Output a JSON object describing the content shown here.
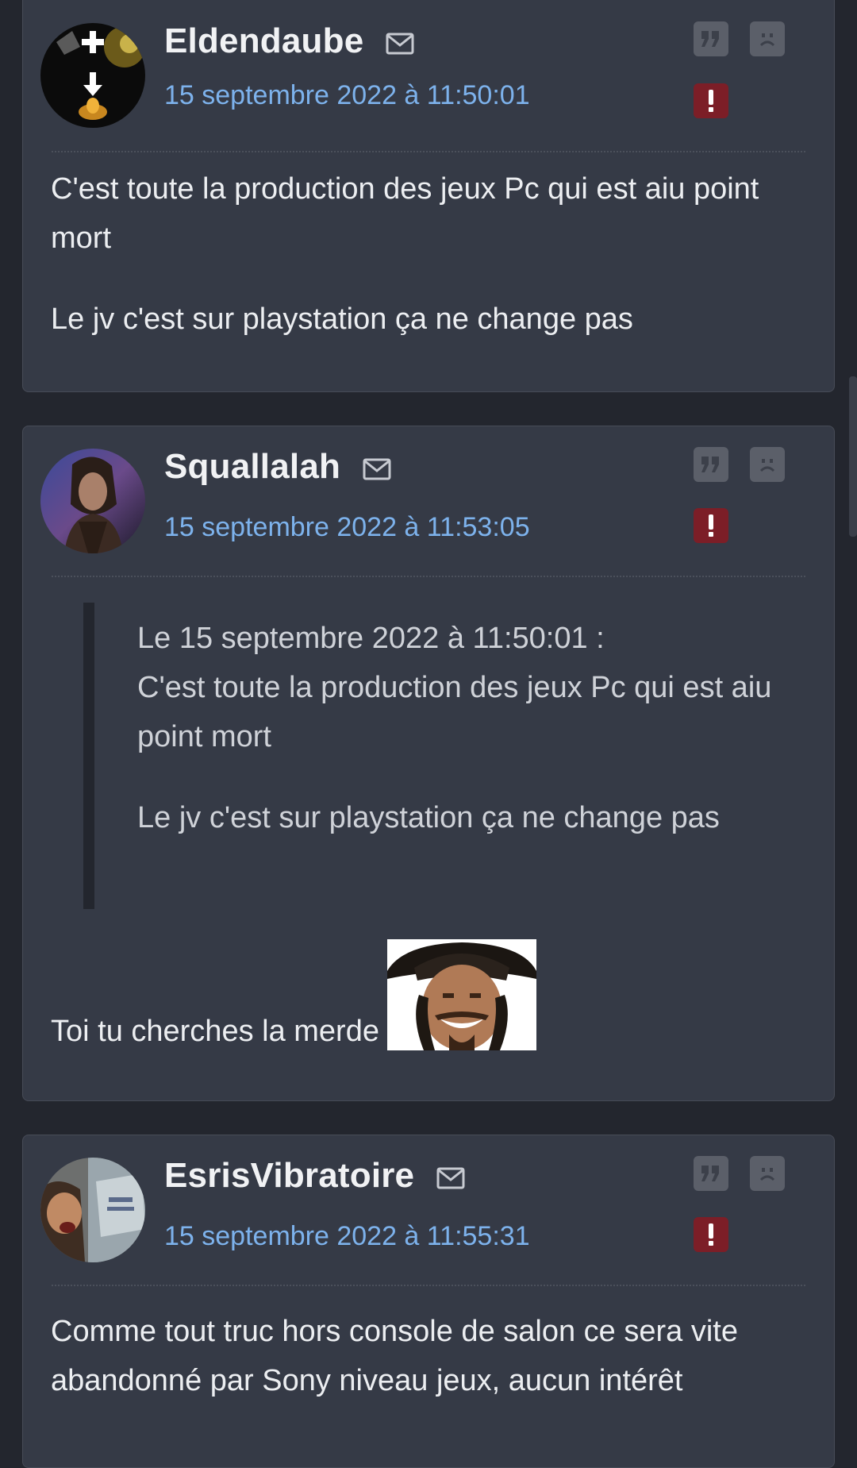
{
  "posts": [
    {
      "author": "Eldendaube",
      "date": "15 septembre 2022 à 11:50:01",
      "paragraphs": [
        "C'est toute la production des jeux Pc qui est aiu point mort",
        "Le jv c'est sur playstation ça ne change pas"
      ]
    },
    {
      "author": "Squallalah",
      "date": "15 septembre 2022 à 11:53:05",
      "quote": {
        "header": "Le 15 septembre 2022 à 11:50:01 :",
        "paragraphs": [
          "C'est toute la production des jeux Pc qui est aiu point mort",
          "Le jv c'est sur playstation ça ne change pas"
        ]
      },
      "reply": "Toi tu cherches la merde"
    },
    {
      "author": "EsrisVibratoire",
      "date": "15 septembre 2022 à 11:55:31",
      "paragraphs": [
        "Comme tout truc hors console de salon ce sera vite abandonné par Sony niveau jeux, aucun intérêt"
      ]
    }
  ],
  "icons": {
    "message": "envelope-icon",
    "quote": "quote-icon",
    "reaction": "sad-face-icon",
    "report": "report-icon"
  },
  "colors": {
    "background": "#23262e",
    "card": "#353a46",
    "date_link": "#7db2ec",
    "report": "#7c1e27",
    "action_button": "#5b5f69"
  }
}
